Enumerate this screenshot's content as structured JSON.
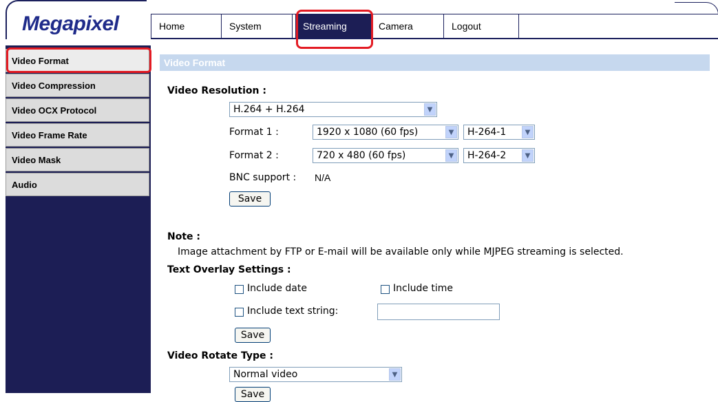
{
  "brand": {
    "logo_text": "Megapixel"
  },
  "topnav": {
    "tabs": [
      {
        "label": "Home"
      },
      {
        "label": "System"
      },
      {
        "label": "Streaming"
      },
      {
        "label": "Camera"
      },
      {
        "label": "Logout"
      }
    ],
    "active": "Streaming"
  },
  "sidebar": {
    "items": [
      {
        "label": "Video Format"
      },
      {
        "label": "Video Compression"
      },
      {
        "label": "Video OCX Protocol"
      },
      {
        "label": "Video Frame Rate"
      },
      {
        "label": "Video Mask"
      },
      {
        "label": "Audio"
      }
    ],
    "active": "Video Format"
  },
  "main": {
    "section_title": "Video Format",
    "video_resolution": {
      "heading": "Video Resolution :",
      "mode_value": "H.264 + H.264",
      "format1_label": "Format 1 :",
      "format1_resolution": "1920 x 1080 (60 fps)",
      "format1_codec": "H-264-1",
      "format2_label": "Format 2 :",
      "format2_resolution": "720 x 480 (60 fps)",
      "format2_codec": "H-264-2",
      "bnc_label": "BNC support :",
      "bnc_value": "N/A",
      "save_label": "Save"
    },
    "note": {
      "heading": "Note :",
      "text": "Image attachment by FTP or E-mail will be available only while MJPEG streaming is selected."
    },
    "text_overlay": {
      "heading": "Text Overlay Settings :",
      "include_date_label": "Include date",
      "include_time_label": "Include time",
      "include_text_label": "Include text string:",
      "text_value": "",
      "save_label": "Save"
    },
    "rotate": {
      "heading": "Video Rotate Type :",
      "value": "Normal video",
      "save_label": "Save"
    }
  },
  "colors": {
    "nav_dark": "#1c1e55",
    "highlight_red": "#e31b23",
    "section_bar": "#c6d8ee",
    "logo_blue": "#1f2b8a"
  }
}
